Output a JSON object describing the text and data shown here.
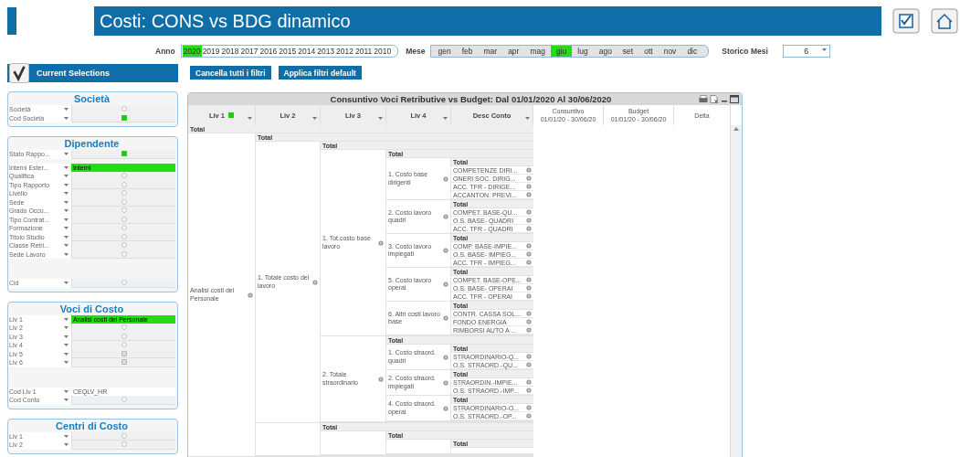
{
  "header": {
    "title": "Costi: CONS vs BDG dinamico"
  },
  "filters": {
    "year_label": "Anno",
    "years": [
      {
        "label": "2020",
        "selected": true
      },
      {
        "label": "2019",
        "selected": false
      },
      {
        "label": "2018",
        "selected": false
      },
      {
        "label": "2017",
        "selected": false
      },
      {
        "label": "2016",
        "selected": false
      },
      {
        "label": "2015",
        "selected": false
      },
      {
        "label": "2014",
        "selected": false
      },
      {
        "label": "2013",
        "selected": false
      },
      {
        "label": "2012",
        "selected": false
      },
      {
        "label": "2011",
        "selected": false
      },
      {
        "label": "2010",
        "selected": false
      }
    ],
    "month_label": "Mese",
    "months": [
      {
        "label": "gen",
        "selected": false
      },
      {
        "label": "feb",
        "selected": false
      },
      {
        "label": "mar",
        "selected": false
      },
      {
        "label": "apr",
        "selected": false
      },
      {
        "label": "mag",
        "selected": false
      },
      {
        "label": "giu",
        "selected": true
      },
      {
        "label": "lug",
        "selected": false
      },
      {
        "label": "ago",
        "selected": false
      },
      {
        "label": "set",
        "selected": false
      },
      {
        "label": "ott",
        "selected": false
      },
      {
        "label": "nov",
        "selected": false
      },
      {
        "label": "dic",
        "selected": false
      }
    ],
    "history_label": "Storico Mesi",
    "history_value": "6"
  },
  "current_selections": {
    "title": "Current Selections"
  },
  "buttons": [
    "Cancella tutti i filtri",
    "Applica filtri default"
  ],
  "panels": [
    {
      "title": "Società",
      "groups": [
        [
          {
            "label": "Società",
            "kind": "empty"
          },
          {
            "label": "Cod Società",
            "kind": "selected"
          }
        ]
      ]
    },
    {
      "title": "Dipendente",
      "groups": [
        [
          {
            "label": "Stato Rappo...",
            "kind": "selected"
          }
        ],
        [
          {
            "label": "Interni Ester...",
            "kind": "value",
            "value": "Interni",
            "selected": true
          },
          {
            "label": "Qualifica",
            "kind": "empty"
          },
          {
            "label": "Tipo Rapporto",
            "kind": "empty"
          },
          {
            "label": "Livello",
            "kind": "empty"
          },
          {
            "label": "Sede",
            "kind": "empty"
          },
          {
            "label": "Grado Occu...",
            "kind": "empty"
          },
          {
            "label": "Tipo Contrat...",
            "kind": "empty"
          },
          {
            "label": "Formazione",
            "kind": "empty"
          },
          {
            "label": "Titolo Studio",
            "kind": "empty"
          },
          {
            "label": "Classe Retri...",
            "kind": "empty"
          },
          {
            "label": "Sede Lavoro",
            "kind": "empty"
          }
        ],
        [
          {
            "label": "Cid",
            "kind": "empty"
          }
        ]
      ]
    },
    {
      "title": "Voci di Costo",
      "groups": [
        [
          {
            "label": "Liv 1",
            "kind": "value",
            "value": "Analisi costi del Personale",
            "selected": true
          },
          {
            "label": "Liv 2",
            "kind": "empty"
          },
          {
            "label": "Liv 3",
            "kind": "empty"
          },
          {
            "label": "Liv 4",
            "kind": "empty"
          },
          {
            "label": "Liv 5",
            "kind": "excluded"
          },
          {
            "label": "Liv 6",
            "kind": "excluded"
          }
        ],
        [
          {
            "label": "Cod Liv 1",
            "kind": "value",
            "value": "CEQLV_HR",
            "selected": false
          },
          {
            "label": "Cod Conto",
            "kind": "empty"
          }
        ]
      ]
    },
    {
      "title": "Centri di Costo",
      "groups": [
        [
          {
            "label": "Liv 1",
            "kind": "empty"
          },
          {
            "label": "Liv 2",
            "kind": "empty"
          }
        ]
      ]
    }
  ],
  "table": {
    "title": "Consuntivo Voci Retributive vs Budget: Dal 01/01/2020 Al 30/06/2020",
    "columns": [
      {
        "label": "Liv 1",
        "filtered": true
      },
      {
        "label": "Liv 2",
        "filtered": false
      },
      {
        "label": "Liv 3",
        "filtered": false
      },
      {
        "label": "Liv 4",
        "filtered": false
      },
      {
        "label": "Desc Conto",
        "filtered": false
      }
    ],
    "measures": [
      {
        "label": "Consuntivo",
        "range": "01/01/20 - 30/06/20"
      },
      {
        "label": "Budget",
        "range": "01/01/20 - 30/06/20"
      },
      {
        "label": "Delta"
      }
    ],
    "rows": {
      "total": "Total",
      "nodes": [
        {
          "label": "Analisi costi del Personale",
          "group": {
            "total": "Total",
            "nodes": [
              {
                "label": "1. Totale costo del lavoro",
                "group": {
                  "total": "Total",
                  "nodes": [
                    {
                      "label": "1. Tot.costo base lavoro",
                      "group": {
                        "total": "Total",
                        "nodes": [
                          {
                            "label": "1. Costo base dirigenti",
                            "group": {
                              "total": "Total",
                              "items": [
                                "COMPETENZE DIRI...",
                                "ONERI SOC. DIRIG...",
                                "ACC. TFR - DIRIGE...",
                                "ACCANTON. PREVI..."
                              ]
                            }
                          },
                          {
                            "label": "2. Costo lavoro quadri",
                            "group": {
                              "total": "Total",
                              "items": [
                                "COMPET. BASE-QU...",
                                "O.S. BASE- QUADRI",
                                "ACC. TFR - QUADRI"
                              ]
                            }
                          },
                          {
                            "label": "3. Costo lavoro impiegati",
                            "group": {
                              "total": "Total",
                              "items": [
                                "COMP. BASE-IMPIE...",
                                "O.S. BASE- IMPIEG...",
                                "ACC. TFR - IMPIEG..."
                              ]
                            }
                          },
                          {
                            "label": "5. Costo lavoro operai",
                            "group": {
                              "total": "Total",
                              "items": [
                                "COMPET. BASE-OPE...",
                                "O.S. BASE- OPERAI",
                                "ACC. TFR - OPERAI"
                              ]
                            }
                          },
                          {
                            "label": "6. Altri costi lavoro base",
                            "group": {
                              "total": "Total",
                              "items": [
                                "CONTR. CASSA SOL...",
                                "FONDO ENERGIA",
                                "RIMBORSI AUTO A ..."
                              ]
                            }
                          }
                        ]
                      }
                    },
                    {
                      "label": "2. Totale straordinario",
                      "group": {
                        "total": "Total",
                        "nodes": [
                          {
                            "label": "1. Costo straord. quadri",
                            "group": {
                              "total": "Total",
                              "items": [
                                "STRAORDINARIO-Q...",
                                "O.S. STRAORD.-QU..."
                              ]
                            }
                          },
                          {
                            "label": "2. Costo straord. impiegati",
                            "group": {
                              "total": "Total",
                              "items": [
                                "STRAORDIN.-IMPIE...",
                                "O.S. STRAORD.-IMP..."
                              ]
                            }
                          },
                          {
                            "label": "4. Costo straord. operai",
                            "group": {
                              "total": "Total",
                              "items": [
                                "STRAORDINARIO-O...",
                                "O.S. STRAORD.-OP..."
                              ]
                            }
                          }
                        ]
                      }
                    }
                  ]
                }
              },
              {
                "group": {
                  "total": "Total",
                  "nodes": [
                    {
                      "group": {
                        "total": "Total",
                        "nodes": [
                          {
                            "group": {
                              "total": "Total"
                            }
                          }
                        ]
                      }
                    }
                  ]
                }
              }
            ]
          }
        }
      ]
    }
  }
}
